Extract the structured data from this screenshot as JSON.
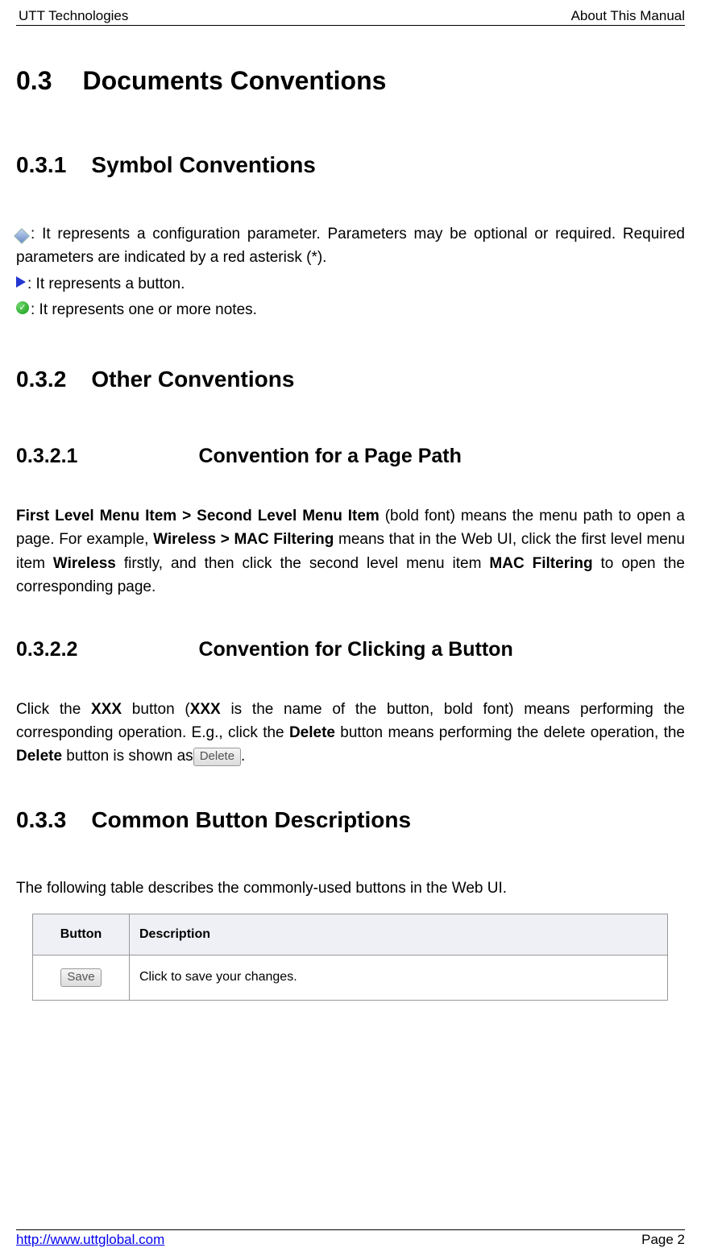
{
  "header": {
    "left": "UTT Technologies",
    "right": "About This Manual"
  },
  "sections": {
    "s03": {
      "num": "0.3",
      "title": "Documents Conventions"
    },
    "s031": {
      "num": "0.3.1",
      "title": "Symbol Conventions"
    },
    "symbolDiamond": ": It represents a configuration parameter. Parameters may be optional or required. Required parameters are indicated by a red asterisk (*).",
    "symbolArrow": ": It represents a button.",
    "symbolCheck": ": It represents one or more notes.",
    "s032": {
      "num": "0.3.2",
      "title": "Other Conventions"
    },
    "s0321": {
      "num": "0.3.2.1",
      "title": "Convention for a Page Path"
    },
    "pagePathParts": {
      "b1": "First Level Menu Item > Second Level Menu Item",
      "t1": " (bold font) means the menu path to open a page. For example, ",
      "b2": "Wireless > MAC Filtering",
      "t2": " means that in the Web UI, click the first level menu item ",
      "b3": "Wireless",
      "t3": " firstly, and then click the second level menu item ",
      "b4": "MAC Filtering",
      "t4": " to open the corresponding page."
    },
    "s0322": {
      "num": "0.3.2.2",
      "title": "Convention for Clicking a Button"
    },
    "clickButtonParts": {
      "t1": "Click the ",
      "b1": "XXX",
      "t2": " button (",
      "b2": "XXX",
      "t3": " is the name of the button, bold font) means performing the corresponding operation. E.g., click the ",
      "b3": "Delete",
      "t4": " button means performing the delete operation, the ",
      "b4": "Delete",
      "t5": " button is shown as",
      "btnLabel": "Delete",
      "t6": "."
    },
    "s033": {
      "num": "0.3.3",
      "title": "Common Button Descriptions"
    },
    "tableIntro": "The following table describes the commonly-used buttons in the Web UI.",
    "table": {
      "h1": "Button",
      "h2": "Description",
      "row1": {
        "btn": "Save",
        "desc": "Click to save your changes."
      }
    }
  },
  "footer": {
    "link": "http://www.uttglobal.com",
    "page": "Page 2"
  }
}
